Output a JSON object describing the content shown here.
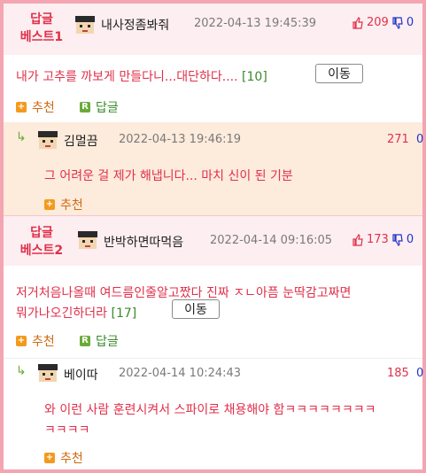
{
  "best1": {
    "label": "답글\n베스트1",
    "nick": "내사정좀봐줘",
    "date": "2022-04-13 19:45:39",
    "up": "209",
    "down": "0",
    "text": "내가 고추를 까보게 만들다니...대단하다....",
    "count": "[10]",
    "move": "이동",
    "recommend": "추천",
    "reply": "답글"
  },
  "reply1": {
    "nick": "김멀끔",
    "date": "2022-04-13 19:46:19",
    "up": "271",
    "down": "0",
    "text": "그 어려운 걸 제가 해냅니다... 마치 신이 된 기분",
    "recommend": "추천"
  },
  "best2": {
    "label": "답글\n베스트2",
    "nick": "반박하면따먹음",
    "date": "2022-04-14 09:16:05",
    "up": "173",
    "down": "0",
    "text_line1": "저거처음나올때 여드름인줄알고짰다 진짜 ㅈㄴ아픔 눈딱감고짜면",
    "text_line2": "뭐가나오긴하더라",
    "count": "[17]",
    "move": "이동",
    "recommend": "추천",
    "reply": "답글"
  },
  "reply2": {
    "nick": "베이따",
    "date": "2022-04-14 10:24:43",
    "up": "185",
    "down": "0",
    "text_line1": "와 이런 사람 훈련시켜서 스파이로 채용해야 함ㅋㅋㅋㅋㅋㅋㅋㅋ",
    "text_line2": "ㅋㅋㅋㅋ",
    "recommend": "추천"
  },
  "icons": {
    "thumbs_up": "thumbs-up-icon",
    "thumbs_down": "thumbs-down-icon",
    "reply_arrow": "reply-arrow-icon",
    "plus": "plus-icon",
    "reply_badge": "reply-badge-icon"
  },
  "colors": {
    "best_bg": "#fdeef1",
    "reply_bg": "#fdebdc",
    "accent_red": "#e0304a",
    "accent_blue": "#2233cc",
    "border_pink": "#f3a6b1"
  }
}
